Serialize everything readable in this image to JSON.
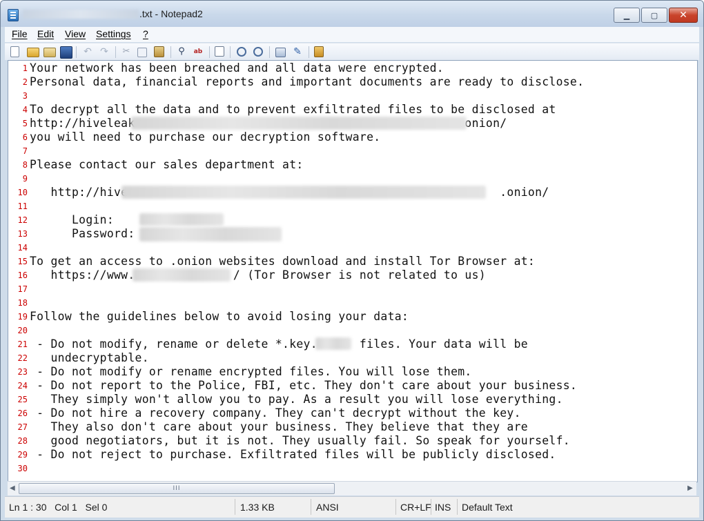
{
  "window": {
    "title_suffix": ".txt - Notepad2",
    "controls": {
      "minimize": "▁",
      "maximize": "▢",
      "close": "✕"
    }
  },
  "menu": [
    "File",
    "Edit",
    "View",
    "Settings",
    "?"
  ],
  "toolbar_icons": [
    "new-icon",
    "open-icon",
    "browse-icon",
    "save-icon",
    "undo-icon",
    "redo-icon",
    "cut-icon",
    "copy-icon",
    "paste-icon",
    "find-icon",
    "replace-icon",
    "word-wrap-icon",
    "zoom-in-icon",
    "zoom-out-icon",
    "scheme-icon",
    "customize-icon",
    "exit-icon"
  ],
  "editor": {
    "lines": [
      {
        "num": "1",
        "text": "Your network has been breached and all data were encrypted."
      },
      {
        "num": "2",
        "text": "Personal data, financial reports and important documents are ready to disclose."
      },
      {
        "num": "3",
        "text": ""
      },
      {
        "num": "4",
        "text": "To decrypt all the data and to prevent exfiltrated files to be disclosed at"
      },
      {
        "num": "5",
        "text": "http://hiveleak                                              .onion/"
      },
      {
        "num": "6",
        "text": "you will need to purchase our decryption software."
      },
      {
        "num": "7",
        "text": ""
      },
      {
        "num": "8",
        "text": "Please contact our sales department at:"
      },
      {
        "num": "9",
        "text": ""
      },
      {
        "num": "10",
        "text": "   http://hive                                                     .onion/"
      },
      {
        "num": "11",
        "text": ""
      },
      {
        "num": "12",
        "text": "      Login:"
      },
      {
        "num": "13",
        "text": "      Password:"
      },
      {
        "num": "14",
        "text": ""
      },
      {
        "num": "15",
        "text": "To get an access to .onion websites download and install Tor Browser at:"
      },
      {
        "num": "16",
        "text": "   https://www.              / (Tor Browser is not related to us)"
      },
      {
        "num": "17",
        "text": ""
      },
      {
        "num": "18",
        "text": ""
      },
      {
        "num": "19",
        "text": "Follow the guidelines below to avoid losing your data:"
      },
      {
        "num": "20",
        "text": ""
      },
      {
        "num": "21",
        "text": " - Do not modify, rename or delete *.key.      files. Your data will be"
      },
      {
        "num": "22",
        "text": "   undecryptable."
      },
      {
        "num": "23",
        "text": " - Do not modify or rename encrypted files. You will lose them."
      },
      {
        "num": "24",
        "text": " - Do not report to the Police, FBI, etc. They don't care about your business."
      },
      {
        "num": "25",
        "text": "   They simply won't allow you to pay. As a result you will lose everything."
      },
      {
        "num": "26",
        "text": " - Do not hire a recovery company. They can't decrypt without the key."
      },
      {
        "num": "27",
        "text": "   They also don't care about your business. They believe that they are"
      },
      {
        "num": "28",
        "text": "   good negotiators, but it is not. They usually fail. So speak for yourself."
      },
      {
        "num": "29",
        "text": " - Do not reject to purchase. Exfiltrated files will be publicly disclosed."
      },
      {
        "num": "30",
        "text": ""
      }
    ]
  },
  "scrollbar": {
    "left_arrow": "◀",
    "right_arrow": "▶",
    "grip": "III"
  },
  "status": {
    "position": "Ln 1 : 30   Col 1   Sel 0",
    "size": "1.33 KB",
    "encoding": "ANSI",
    "line_ending": "CR+LF",
    "mode": "INS",
    "scheme": "Default Text"
  }
}
